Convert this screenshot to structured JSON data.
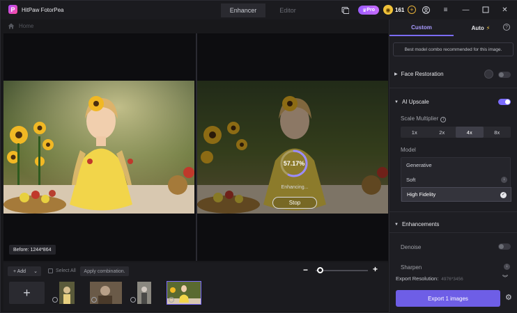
{
  "app": {
    "title": "HitPaw FotorPea",
    "modes": [
      "Enhancer",
      "Editor"
    ],
    "active_mode": "Enhancer",
    "pro_label": "Pro",
    "credits": "161"
  },
  "breadcrumb": {
    "home_label": "Home"
  },
  "canvas": {
    "before_label": "Before: 1244*864",
    "progress_percent": 57.17,
    "progress_label": "57.17%",
    "status_text": "Enhancing...",
    "stop_label": "Stop"
  },
  "bottom": {
    "add_label": "+ Add",
    "select_all_label": "Select All",
    "apply_label": "Apply combination.",
    "zoom_out": "−",
    "zoom_in": "+",
    "add_tile": "+",
    "zoom_level": 0.05
  },
  "panel": {
    "tabs": {
      "custom": "Custom",
      "auto": "Auto"
    },
    "notice": "Best model combo recommended for this image.",
    "face_restoration": {
      "label": "Face Restoration",
      "enabled": false
    },
    "ai_upscale": {
      "label": "AI Upscale",
      "enabled": true,
      "scale_label": "Scale Multiplier",
      "scales": [
        "1x",
        "2x",
        "4x",
        "8x"
      ],
      "selected_scale": "4x",
      "model_label": "Model",
      "models": [
        "Generative",
        "Soft",
        "High Fidelity"
      ],
      "selected_model": "High Fidelity"
    },
    "enhancements": {
      "label": "Enhancements",
      "denoise_label": "Denoise",
      "denoise_enabled": false,
      "sharpen_label": "Sharpen"
    },
    "export": {
      "resolution_label": "Export Resolution:",
      "resolution_value": "4976*3456",
      "button_label": "Export 1 images"
    }
  },
  "colors": {
    "accent": "#7b6cff",
    "export_button": "#6e5ee6",
    "pro_badge": "#b06cff",
    "coin": "#f0c23a"
  }
}
